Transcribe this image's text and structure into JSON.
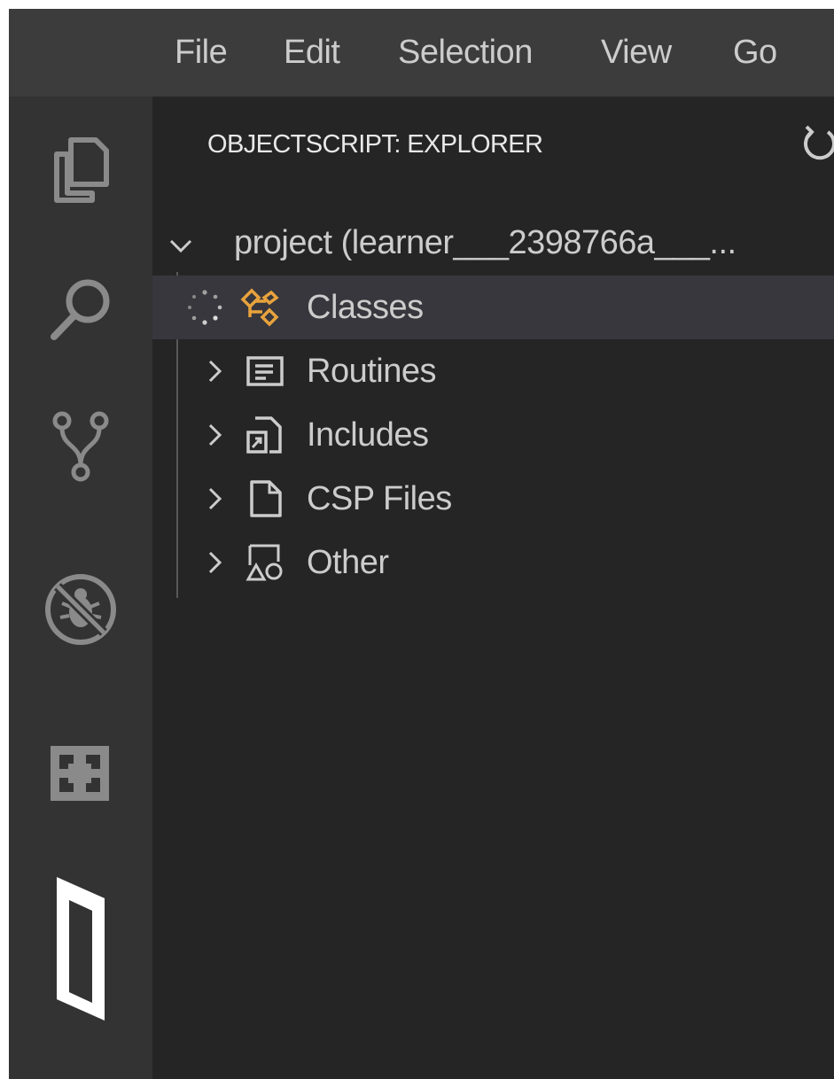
{
  "menubar": {
    "items": [
      {
        "label": "File"
      },
      {
        "label": "Edit"
      },
      {
        "label": "Selection"
      },
      {
        "label": "View"
      },
      {
        "label": "Go"
      }
    ]
  },
  "activitybar": {
    "icons": [
      "files-icon",
      "search-icon",
      "source-control-icon",
      "debug-disabled-icon",
      "extensions-icon",
      "intersystems-objectscript-icon"
    ]
  },
  "explorer": {
    "title": "OBJECTSCRIPT: EXPLORER",
    "project": {
      "label": "project (learner___2398766a___..."
    },
    "items": [
      {
        "label": "Classes",
        "icon": "classes-icon",
        "state": "loading"
      },
      {
        "label": "Routines",
        "icon": "routines-icon"
      },
      {
        "label": "Includes",
        "icon": "includes-icon"
      },
      {
        "label": "CSP Files",
        "icon": "csp-file-icon"
      },
      {
        "label": "Other",
        "icon": "other-icon"
      }
    ]
  },
  "colors": {
    "menubar": "#3c3c3c",
    "activitybar": "#333333",
    "sidebar": "#252526",
    "selection": "#37373d",
    "classes_icon": "#e8a33d"
  }
}
